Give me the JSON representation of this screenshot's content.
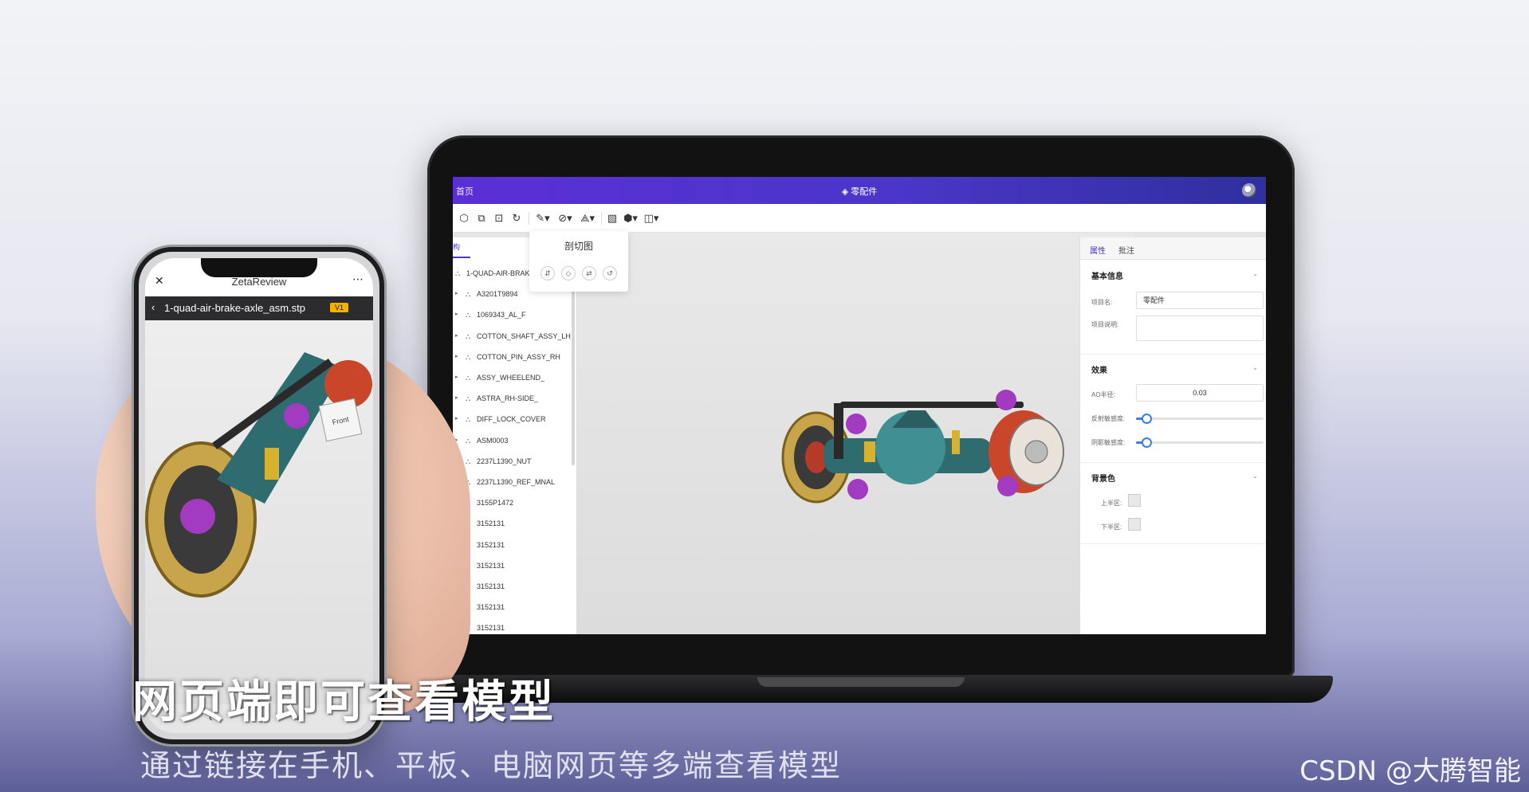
{
  "web_app": {
    "home_link": "首页",
    "window_title": "零配件",
    "section_popover_title": "剖切图",
    "structure_tab": "构",
    "tree_items": [
      "1-QUAD-AIR-BRAK",
      "A3201T9894",
      "1069343_AL_F",
      "COTTON_SHAFT_ASSY_LH",
      "COTTON_PIN_ASSY_RH",
      "ASSY_WHEELEND_",
      "ASTRA_RH-SIDE_",
      "DIFF_LOCK_COVER",
      "ASM0003",
      "2237L1390_NUT",
      "2237L1390_REF_MNAL",
      "3155P1472",
      "3152131",
      "3152131",
      "3152131",
      "3152131",
      "3152131",
      "3152131"
    ],
    "props": {
      "tab_attributes": "属性",
      "tab_comments": "批注",
      "basic_info_title": "基本信息",
      "project_name_label": "项目名:",
      "project_name_value": "零配件",
      "project_desc_label": "项目说明:",
      "project_desc_value": "",
      "effects_title": "效果",
      "ao_radius_label": "AO半径:",
      "ao_radius_value": "0.03",
      "reflection_label": "反射敏感度:",
      "reflection_level": 0.08,
      "shadow_label": "阴影敏感度:",
      "shadow_level": 0.08,
      "background_title": "背景色",
      "upper_half_label": "上半区:",
      "lower_half_label": "下半区:",
      "accent_color": "#4a36c8"
    }
  },
  "phone_app": {
    "app_name": "ZetaReview",
    "file_name": "1-quad-air-brake-axle_asm.stp",
    "version_badge": "V1",
    "view_cube_label": "Front"
  },
  "captions": {
    "main": "网页端即可查看模型",
    "sub": "通过链接在手机、平板、电脑网页等多端查看模型",
    "watermark": "CSDN @大腾智能"
  }
}
